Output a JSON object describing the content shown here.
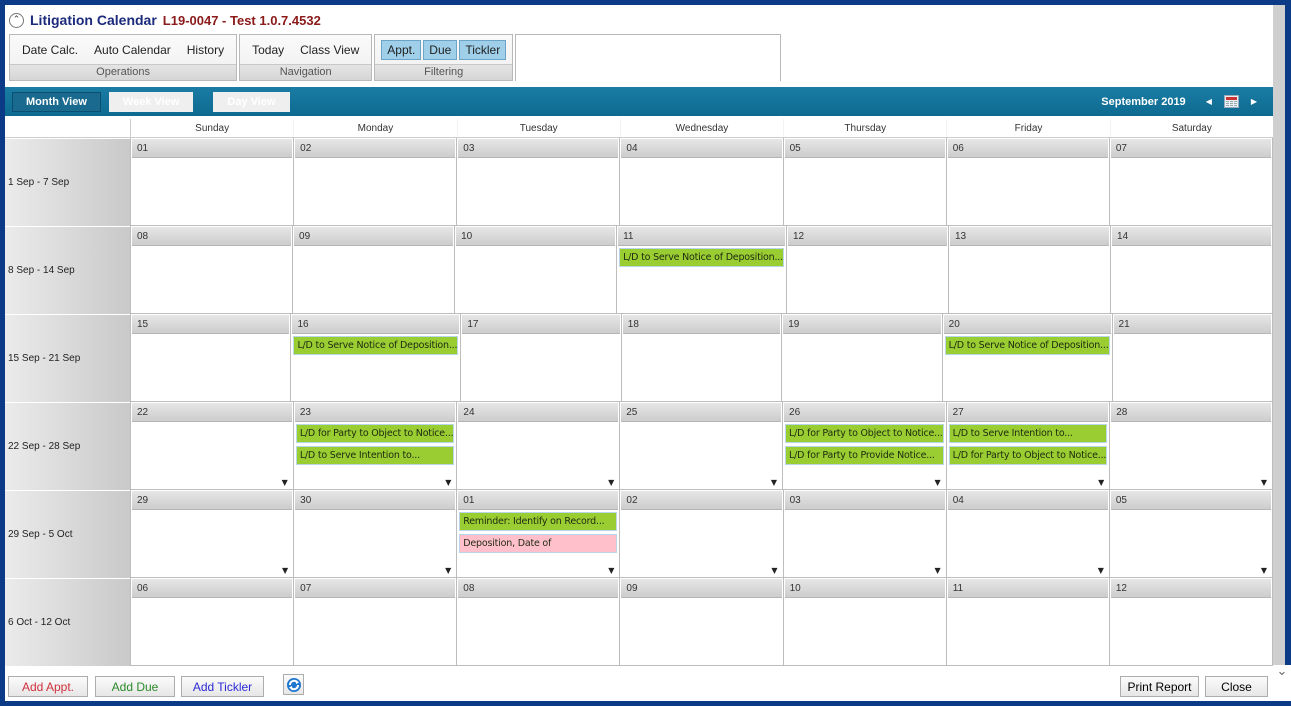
{
  "title": {
    "main": "Litigation Calendar",
    "sub": "L19-0047 - Test 1.0.7.4532",
    "collapse_glyph": "^"
  },
  "ribbon": {
    "groups": [
      {
        "label": "Operations",
        "buttons": [
          {
            "label": "Date Calc."
          },
          {
            "label": "Auto Calendar"
          },
          {
            "label": "History"
          }
        ]
      },
      {
        "label": "Navigation",
        "buttons": [
          {
            "label": "Today"
          },
          {
            "label": "Class View"
          }
        ]
      },
      {
        "label": "Filtering",
        "buttons": [
          {
            "label": "Appt.",
            "active": true
          },
          {
            "label": "Due",
            "active": true
          },
          {
            "label": "Tickler",
            "active": true
          }
        ]
      }
    ]
  },
  "navbar": {
    "views": [
      {
        "label": "Month View",
        "active": true
      },
      {
        "label": "Week View"
      },
      {
        "label": "Day View"
      }
    ],
    "month_label": "September 2019",
    "prev_glyph": "◀",
    "next_glyph": "▶"
  },
  "calendar": {
    "day_headers": [
      "Sunday",
      "Monday",
      "Tuesday",
      "Wednesday",
      "Thursday",
      "Friday",
      "Saturday"
    ],
    "weeks": [
      {
        "label": "1 Sep - 7 Sep",
        "days": [
          {
            "num": "01"
          },
          {
            "num": "02"
          },
          {
            "num": "03"
          },
          {
            "num": "04"
          },
          {
            "num": "05"
          },
          {
            "num": "06"
          },
          {
            "num": "07"
          }
        ]
      },
      {
        "label": "8 Sep - 14 Sep",
        "days": [
          {
            "num": "08"
          },
          {
            "num": "09"
          },
          {
            "num": "10"
          },
          {
            "num": "11",
            "events": [
              {
                "text": "L/D to Serve Notice of Deposition...",
                "color": "green"
              }
            ]
          },
          {
            "num": "12"
          },
          {
            "num": "13"
          },
          {
            "num": "14"
          }
        ]
      },
      {
        "label": "15 Sep - 21 Sep",
        "days": [
          {
            "num": "15"
          },
          {
            "num": "16",
            "events": [
              {
                "text": "L/D to Serve Notice of Deposition...",
                "color": "green"
              }
            ]
          },
          {
            "num": "17"
          },
          {
            "num": "18"
          },
          {
            "num": "19"
          },
          {
            "num": "20",
            "events": [
              {
                "text": "L/D to Serve Notice of Deposition...",
                "color": "green"
              }
            ]
          },
          {
            "num": "21"
          }
        ]
      },
      {
        "label": "22 Sep - 28 Sep",
        "days": [
          {
            "num": "22",
            "more": true
          },
          {
            "num": "23",
            "more": true,
            "events": [
              {
                "text": "L/D for Party to Object to Notice...",
                "color": "green"
              },
              {
                "text": "L/D to Serve Intention to...",
                "color": "green"
              }
            ]
          },
          {
            "num": "24",
            "more": true
          },
          {
            "num": "25",
            "more": true
          },
          {
            "num": "26",
            "more": true,
            "events": [
              {
                "text": "L/D for Party to Object to Notice...",
                "color": "green"
              },
              {
                "text": "L/D for Party to Provide Notice...",
                "color": "green"
              }
            ]
          },
          {
            "num": "27",
            "more": true,
            "events": [
              {
                "text": "L/D to Serve Intention to...",
                "color": "green"
              },
              {
                "text": "L/D for Party to Object to Notice...",
                "color": "green"
              }
            ]
          },
          {
            "num": "28",
            "more": true
          }
        ]
      },
      {
        "label": "29 Sep - 5 Oct",
        "days": [
          {
            "num": "29",
            "more": true
          },
          {
            "num": "30",
            "more": true
          },
          {
            "num": "01",
            "more": true,
            "events": [
              {
                "text": "Reminder: Identify on Record...",
                "color": "green"
              },
              {
                "text": "Deposition, Date of",
                "color": "pink"
              }
            ]
          },
          {
            "num": "02",
            "more": true
          },
          {
            "num": "03",
            "more": true
          },
          {
            "num": "04",
            "more": true
          },
          {
            "num": "05",
            "more": true
          }
        ]
      },
      {
        "label": "6 Oct - 12 Oct",
        "days": [
          {
            "num": "06"
          },
          {
            "num": "07"
          },
          {
            "num": "08"
          },
          {
            "num": "09"
          },
          {
            "num": "10"
          },
          {
            "num": "11"
          },
          {
            "num": "12"
          }
        ]
      }
    ],
    "more_glyph": "▼"
  },
  "footer": {
    "add_appt": "Add Appt.",
    "add_due": "Add Due",
    "add_tickler": "Add Tickler",
    "print_report": "Print Report",
    "close": "Close"
  },
  "colors": {
    "frame": "#0b3a86",
    "navbar": "#1a7ca4",
    "event_green": "#9acd32",
    "event_pink": "#ffc0cb",
    "add_appt": "#d0303c",
    "add_due": "#2a8a2a",
    "add_tickler": "#2b2bd6",
    "title_main": "#1b2a7c",
    "title_sub": "#8b1a1a"
  }
}
